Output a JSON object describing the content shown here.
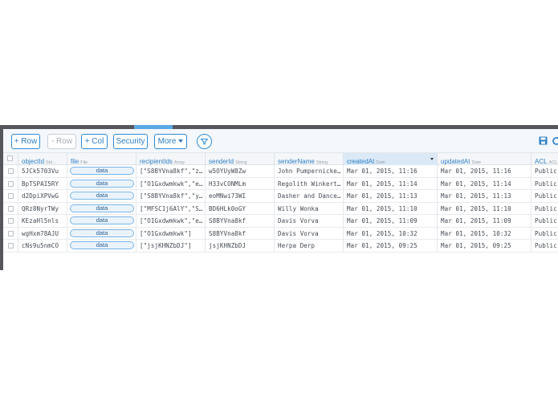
{
  "toolbar": {
    "add_row": "+ Row",
    "remove_row": "- Row",
    "add_col": "+ Col",
    "security": "Security",
    "more": "More"
  },
  "columns": [
    {
      "name": "objectId",
      "type": "Stri…"
    },
    {
      "name": "file",
      "type": "File"
    },
    {
      "name": "recipientIds",
      "type": "Array"
    },
    {
      "name": "senderId",
      "type": "String"
    },
    {
      "name": "senderName",
      "type": "String"
    },
    {
      "name": "createdAt",
      "type": "Date"
    },
    {
      "name": "updatedAt",
      "type": "Date"
    },
    {
      "name": "ACL",
      "type": "ACL"
    }
  ],
  "rows": [
    {
      "objectId": "5JCk5703Vu",
      "file": "data",
      "recipientIds": "[\"S8BYVna8kf\",\"z…",
      "senderId": "w5OYUyW8Zw",
      "senderName": "John Pumpernicke…",
      "createdAt": "Mar 01, 2015, 11:16",
      "updatedAt": "Mar 01, 2015, 11:16",
      "acl": "Public"
    },
    {
      "objectId": "BpTSPAI5RY",
      "file": "data",
      "recipientIds": "[\"O1Gxdwmkwk\",\"e…",
      "senderId": "H33vCONMLm",
      "senderName": "Regolith Winkert…",
      "createdAt": "Mar 01, 2015, 11:14",
      "updatedAt": "Mar 01, 2015, 11:14",
      "acl": "Public"
    },
    {
      "objectId": "d2DpiXPVwG",
      "file": "data",
      "recipientIds": "[\"S8BYVna8kf\",\"y…",
      "senderId": "eoMNwi73WI",
      "senderName": "Dasher and Dance…",
      "createdAt": "Mar 01, 2015, 11:13",
      "updatedAt": "Mar 01, 2015, 11:13",
      "acl": "Public"
    },
    {
      "objectId": "QRz8NyrTWy",
      "file": "data",
      "recipientIds": "[\"MFSC1j6AlY\",\"S…",
      "senderId": "BD6HLk0oGY",
      "senderName": "Willy Wonka",
      "createdAt": "Mar 01, 2015, 11:10",
      "updatedAt": "Mar 01, 2015, 11:10",
      "acl": "Public"
    },
    {
      "objectId": "KEzaHl5nls",
      "file": "data",
      "recipientIds": "[\"O1Gxdwmkwk\",\"e…",
      "senderId": "S8BYVna8kf",
      "senderName": "Davis Vorva",
      "createdAt": "Mar 01, 2015, 11:09",
      "updatedAt": "Mar 01, 2015, 11:09",
      "acl": "Public"
    },
    {
      "objectId": "wgHxm78AJU",
      "file": "data",
      "recipientIds": "[\"O1Gxdwmkwk\"]",
      "senderId": "S8BYVna8kf",
      "senderName": "Davis Vorva",
      "createdAt": "Mar 01, 2015, 10:32",
      "updatedAt": "Mar 01, 2015, 10:32",
      "acl": "Public"
    },
    {
      "objectId": "cNs9u5nmCO",
      "file": "data",
      "recipientIds": "[\"jsjKHNZbDJ\"]",
      "senderId": "jsjKHNZbDJ",
      "senderName": "Herpa Derp",
      "createdAt": "Mar 01, 2015, 09:25",
      "updatedAt": "Mar 01, 2015, 09:25",
      "acl": "Public"
    }
  ],
  "colors": {
    "accent": "#2e8cd6",
    "frame": "#55575d",
    "active_header": "#dbe9f7"
  }
}
